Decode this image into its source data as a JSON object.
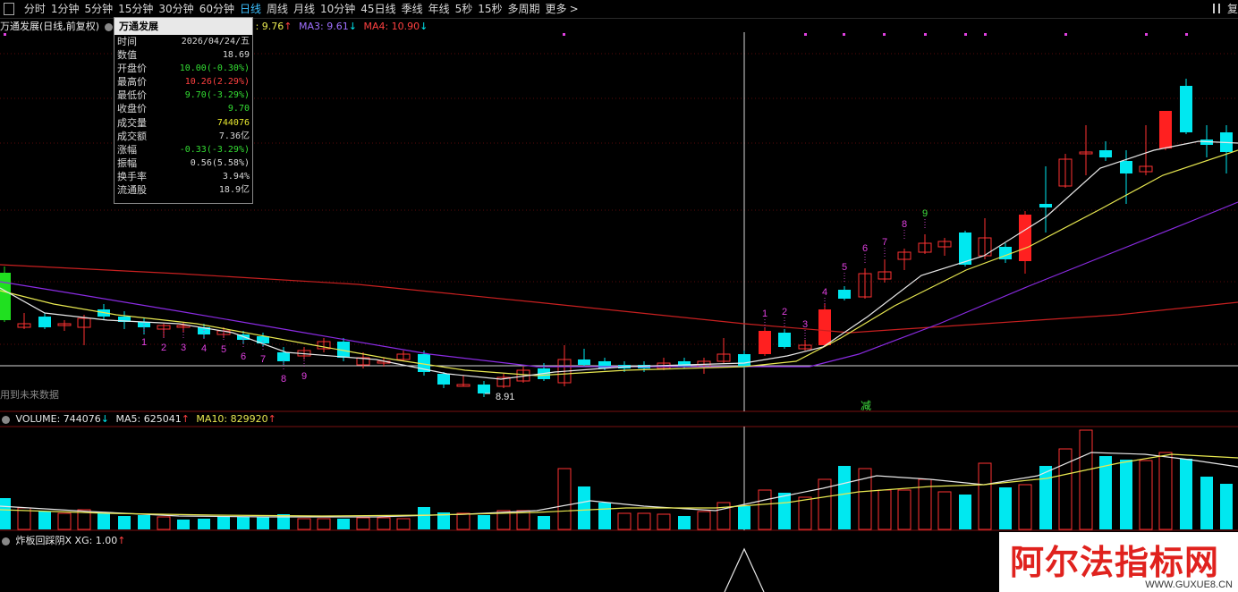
{
  "toolbar": {
    "items": [
      "分时",
      "1分钟",
      "5分钟",
      "15分钟",
      "30分钟",
      "60分钟",
      "日线",
      "周线",
      "月线",
      "10分钟",
      "45日线",
      "季线",
      "年线",
      "5秒",
      "15秒",
      "多周期",
      "更多"
    ],
    "active": "日线",
    "more_arrow": ">",
    "right_label": "复"
  },
  "main_legend": {
    "title": "万通发展(日线,前复权)",
    "ma2_partial": ": 9.76",
    "ma3": "MA3: 9.61",
    "ma4": "MA4: 10.90",
    "up": "↑",
    "down": "↓"
  },
  "info_box": {
    "title": "万通发展",
    "rows": [
      {
        "label": "时间",
        "value": "2026/04/24/五",
        "color": "#d8d8d8"
      },
      {
        "label": "数值",
        "value": "18.69",
        "color": "#d8d8d8"
      },
      {
        "label": "开盘价",
        "value": "10.00(-0.30%)",
        "color": "#33dd33"
      },
      {
        "label": "最高价",
        "value": "10.26(2.29%)",
        "color": "#ff4040"
      },
      {
        "label": "最低价",
        "value": "9.70(-3.29%)",
        "color": "#33dd33"
      },
      {
        "label": "收盘价",
        "value": "9.70",
        "color": "#33dd33"
      },
      {
        "label": "成交量",
        "value": "744076",
        "color": "#e8e830"
      },
      {
        "label": "成交额",
        "value": "7.36亿",
        "color": "#d8d8d8"
      },
      {
        "label": "涨幅",
        "value": "-0.33(-3.29%)",
        "color": "#33dd33"
      },
      {
        "label": "振幅",
        "value": "0.56(5.58%)",
        "color": "#d8d8d8"
      },
      {
        "label": "换手率",
        "value": "3.94%",
        "color": "#d8d8d8"
      },
      {
        "label": "流通股",
        "value": "18.9亿",
        "color": "#d8d8d8"
      }
    ]
  },
  "future_text": "用到未来数据",
  "vol_legend": {
    "volume": "VOLUME: 744076",
    "ma5": "MA5: 625041",
    "ma10": "MA10: 829920",
    "up": "↑",
    "down": "↓"
  },
  "ind_legend": {
    "text": "炸板回踩阴X XG: 1.00",
    "up": "↑"
  },
  "chart_labels": {
    "low_price": "8.91",
    "jian": "减"
  },
  "seq_down": [
    "1",
    "2",
    "3",
    "4",
    "5",
    "6",
    "7",
    "8",
    "9"
  ],
  "seq_up": [
    "1",
    "2",
    "3",
    "4",
    "5",
    "6",
    "7",
    "8",
    "9"
  ],
  "colors": {
    "up": "#ff3232",
    "down": "#00e8f0",
    "ma_white": "#e8e8e8",
    "ma_yellow": "#e8e850",
    "ma_purple": "#8a2be2",
    "ma_red": "#c82020",
    "seq_down": "#e040e0",
    "seq_up_9": "#40e040",
    "limit_up_fill": "#ff2020"
  },
  "watermark": {
    "big": "阿尔法指标网",
    "small": "WWW.GUXUE8.CN"
  }
}
